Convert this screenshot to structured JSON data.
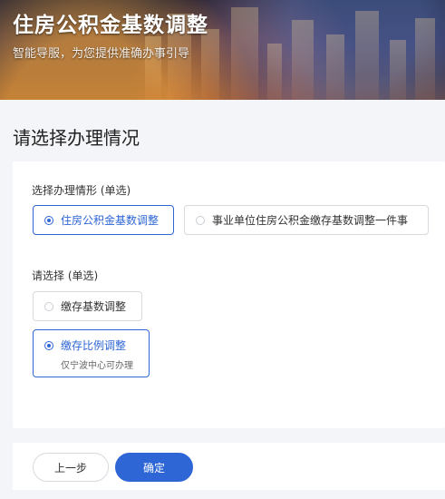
{
  "header": {
    "title": "住房公积金基数调整",
    "subtitle": "智能导服，为您提供准确办事引导"
  },
  "section": {
    "heading": "请选择办理情况"
  },
  "questions": [
    {
      "label": "选择办理情形 (单选)",
      "options": [
        {
          "label": "住房公积金基数调整",
          "selected": true
        },
        {
          "label": "事业单位住房公积金缴存基数调整一件事",
          "selected": false
        }
      ]
    },
    {
      "label": "请选择 (单选)",
      "options": [
        {
          "label": "缴存基数调整",
          "selected": false
        },
        {
          "label": "缴存比例调整",
          "note": "仅宁波中心可办理",
          "selected": true
        }
      ]
    }
  ],
  "footer": {
    "prev_label": "上一步",
    "confirm_label": "确定"
  },
  "colors": {
    "accent": "#2e66d6",
    "background": "#f3f5f8"
  }
}
